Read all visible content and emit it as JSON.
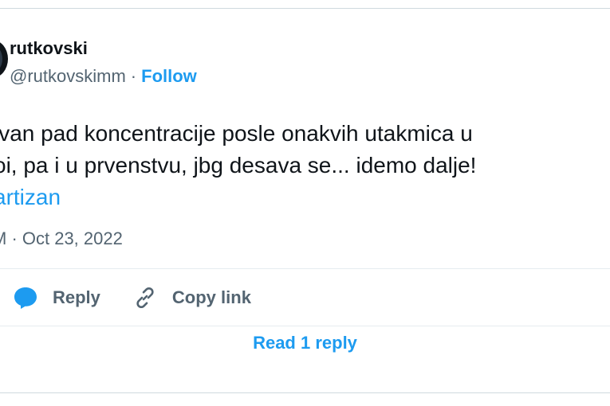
{
  "author": {
    "display_name": "rutkovski",
    "handle": "@rutkovskimm",
    "separator": "·",
    "follow_label": "Follow"
  },
  "tweet": {
    "lines": [
      "ivan pad koncentracije posle onakvih utakmica u",
      "oi, pa i u prvenstvu, jbg desava se... idemo dalje!"
    ],
    "hashtag": "artizan",
    "timestamp": "M · Oct 23, 2022"
  },
  "actions": {
    "reply_label": "Reply",
    "copy_link_label": "Copy link"
  },
  "read_replies_label": "Read 1 reply",
  "colors": {
    "accent": "#1d9bf0",
    "text": "#0f1419",
    "muted": "#536471",
    "border": "#cfd9de"
  }
}
